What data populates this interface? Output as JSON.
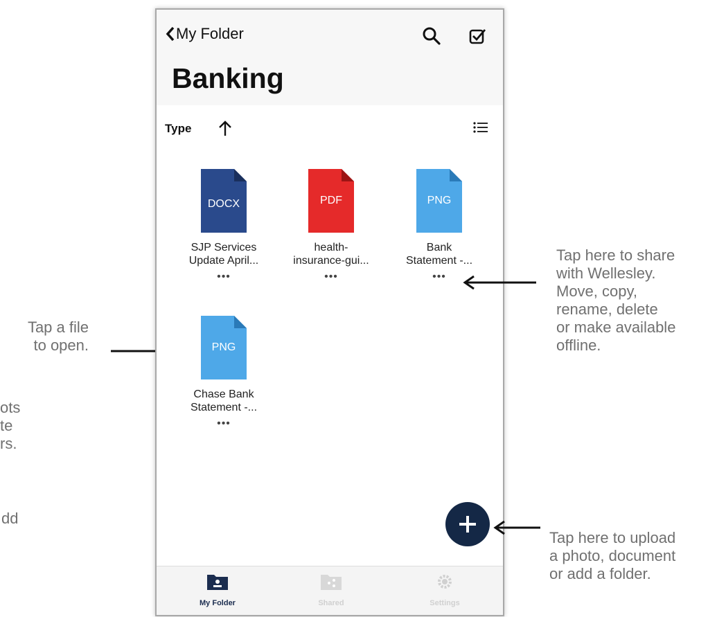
{
  "nav": {
    "back_label": "My Folder"
  },
  "page": {
    "title": "Banking"
  },
  "sort": {
    "label": "Type"
  },
  "files": [
    {
      "type": "DOCX",
      "name_line1": "SJP Services",
      "name_line2": "Update April...",
      "more": "•••",
      "color": "#2a4a8c"
    },
    {
      "type": "PDF",
      "name_line1": "health-",
      "name_line2": "insurance-gui...",
      "more": "•••",
      "color": "#e52a2a"
    },
    {
      "type": "PNG",
      "name_line1": "Bank",
      "name_line2": "Statement -...",
      "more": "•••",
      "color": "#4ea8e8"
    },
    {
      "type": "PNG",
      "name_line1": "Chase Bank",
      "name_line2": "Statement -...",
      "more": "•••",
      "color": "#4ea8e8"
    }
  ],
  "tabs": [
    {
      "label": "My Folder",
      "icon": "folder-user-icon",
      "active": true
    },
    {
      "label": "Shared",
      "icon": "shared-folder-icon",
      "active": false
    },
    {
      "label": "Settings",
      "icon": "gear-icon",
      "active": false
    }
  ],
  "annotations": {
    "open_line1": "Tap a file",
    "open_line2": "to open.",
    "share_line1": "Tap here to share",
    "share_line2": "with Wellesley.",
    "share_line3": "Move, copy,",
    "share_line4": "rename, delete",
    "share_line5": "or make available",
    "share_line6": "offline.",
    "upload_line1": "Tap here to upload",
    "upload_line2": "a photo, document",
    "upload_line3": "or add a folder.",
    "cut1_line1": "ots",
    "cut1_line2": "te",
    "cut1_line3": "rs.",
    "cut2_line1": "dd"
  },
  "colors": {
    "fab": "#142846",
    "annotation_text": "#707070"
  }
}
